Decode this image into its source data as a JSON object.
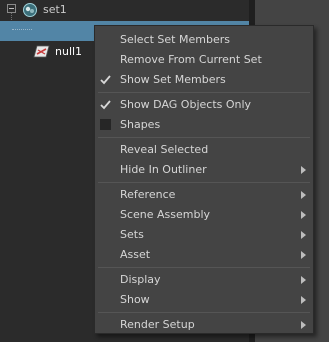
{
  "outliner": {
    "items": [
      {
        "label": "set1",
        "icon": "set-icon"
      },
      {
        "label": "null1",
        "icon": "null-transform-icon",
        "selected": true
      }
    ]
  },
  "context_menu": {
    "items": [
      {
        "label": "Select Set Members"
      },
      {
        "label": "Remove From Current Set"
      },
      {
        "label": "Show Set Members",
        "checked": true
      },
      {
        "label": "Show DAG Objects Only",
        "checked": true
      },
      {
        "label": "Shapes",
        "checked": false
      },
      {
        "label": "Reveal Selected"
      },
      {
        "label": "Hide In Outliner",
        "submenu": true
      },
      {
        "label": "Reference",
        "submenu": true
      },
      {
        "label": "Scene Assembly",
        "submenu": true
      },
      {
        "label": "Sets",
        "submenu": true
      },
      {
        "label": "Asset",
        "submenu": true
      },
      {
        "label": "Display",
        "submenu": true
      },
      {
        "label": "Show",
        "submenu": true
      },
      {
        "label": "Render Setup",
        "submenu": true
      }
    ]
  },
  "colors": {
    "selection_highlight": "#5285a6",
    "outliner_background": "#2b2b2b",
    "menu_background": "#444444",
    "menu_text": "#d6d6d6"
  }
}
